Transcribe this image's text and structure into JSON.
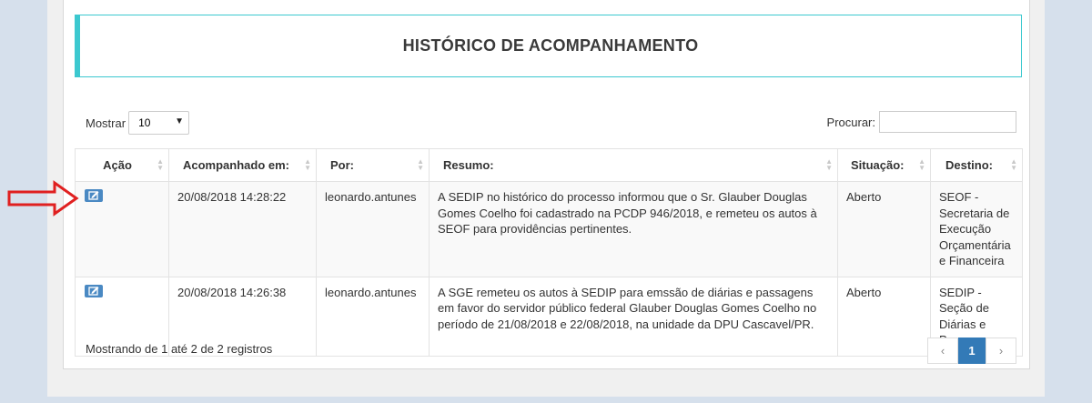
{
  "header": {
    "title": "HISTÓRICO DE ACOMPANHAMENTO"
  },
  "controls": {
    "length_label": "Mostrar",
    "length_value": "10",
    "search_label": "Procurar:"
  },
  "table": {
    "columns": [
      "Ação",
      "Acompanhado em:",
      "Por:",
      "Resumo:",
      "Situação:",
      "Destino:"
    ],
    "rows": [
      {
        "date": "20/08/2018 14:28:22",
        "by": "leonardo.antunes",
        "summary": "A SEDIP no histórico do processo informou que o Sr. Glauber Douglas Gomes Coelho foi cadastrado na PCDP 946/2018, e remeteu os autos à SEOF para providências pertinentes.",
        "status": "Aberto",
        "destination": "SEOF - Secretaria de Execução Orçamentária e Financeira"
      },
      {
        "date": "20/08/2018 14:26:38",
        "by": "leonardo.antunes",
        "summary": "A SGE remeteu os autos à SEDIP para emssão de diárias e passagens em favor do servidor público federal Glauber Douglas Gomes Coelho no período de 21/08/2018 e 22/08/2018, na unidade da DPU Cascavel/PR.",
        "status": "Aberto",
        "destination": "SEDIP - Seção de Diárias e Passagens"
      }
    ]
  },
  "footer": {
    "info": "Mostrando de 1 até 2 de 2 registros",
    "pager_prev": "‹",
    "pager_current": "1",
    "pager_next": "›"
  },
  "colors": {
    "accent": "#3cc8cf",
    "primary": "#337ab7",
    "arrow": "#e02020"
  },
  "icons": {
    "edit": "edit-icon",
    "sort": "sort-icon",
    "annotation": "red-arrow-icon"
  }
}
